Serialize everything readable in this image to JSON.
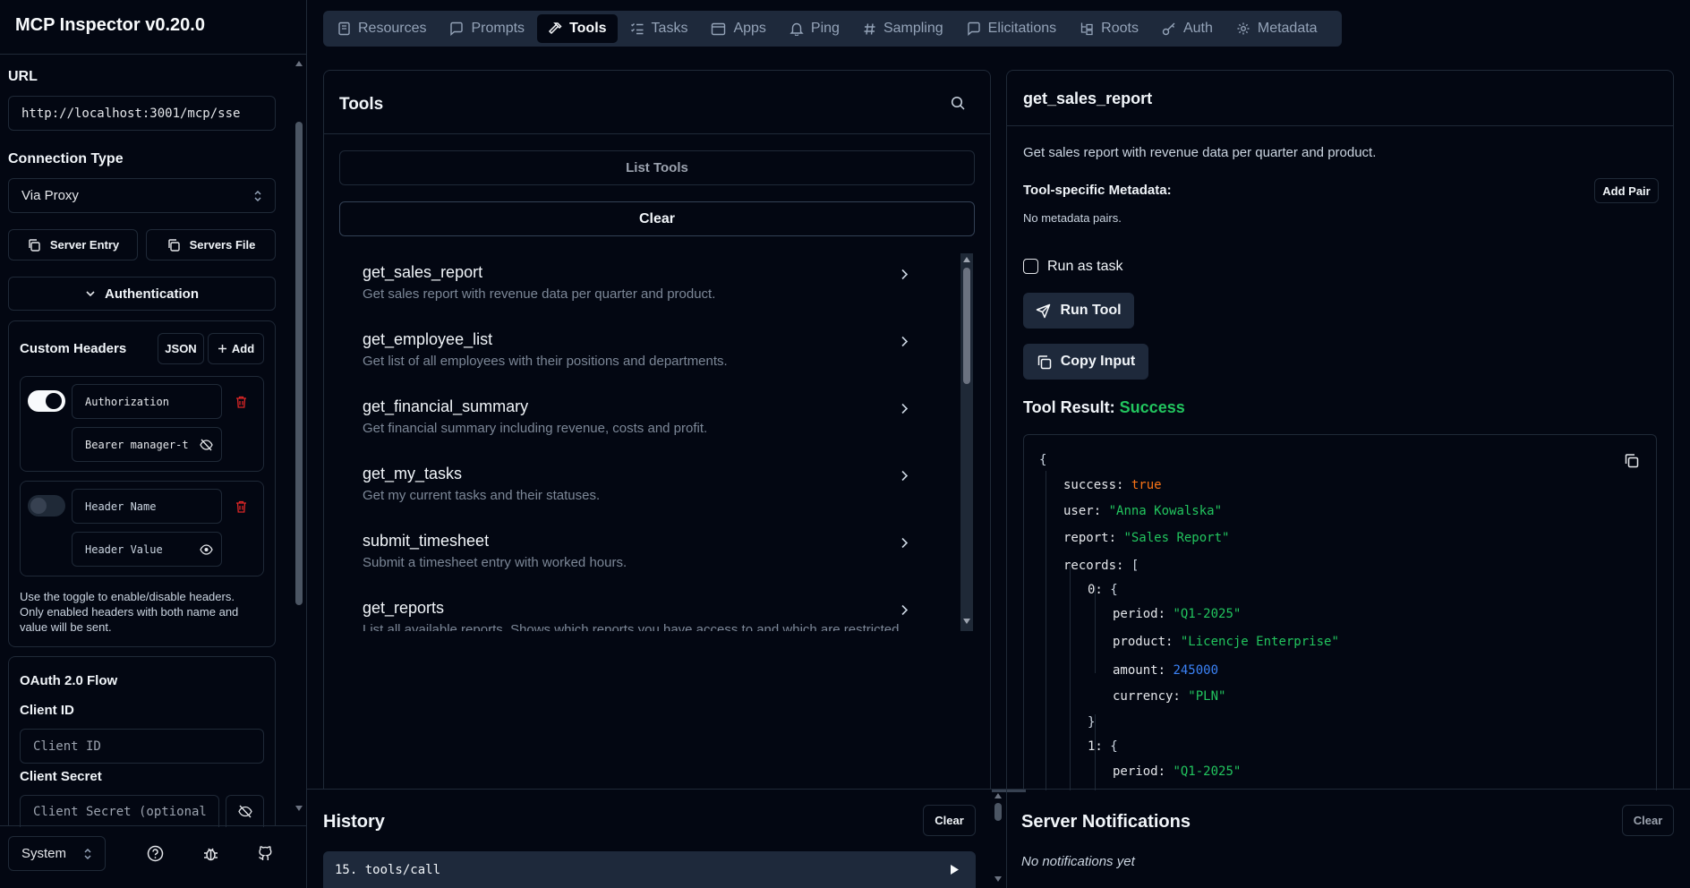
{
  "sidebar": {
    "app_title": "MCP Inspector v0.20.0",
    "url_label": "URL",
    "url_value": "http://localhost:3001/mcp/sse",
    "connection_type_label": "Connection Type",
    "connection_type_value": "Via Proxy",
    "server_entry_label": "Server Entry",
    "servers_file_label": "Servers File",
    "authentication_label": "Authentication",
    "custom_headers_label": "Custom Headers",
    "json_button": "JSON",
    "add_button": "Add",
    "header1_name": "Authorization",
    "header1_value": "Bearer manager-t⁠",
    "header2_name_placeholder": "Header Name",
    "header2_value_placeholder": "Header Value",
    "headers_hint": "Use the toggle to enable/disable headers. Only enabled headers with both name and value will be sent.",
    "oauth_title": "OAuth 2.0 Flow",
    "client_id_label": "Client ID",
    "client_id_placeholder": "Client ID",
    "client_secret_label": "Client Secret",
    "client_secret_placeholder": "Client Secret (optional",
    "theme_value": "System"
  },
  "tabs": [
    {
      "label": "Resources"
    },
    {
      "label": "Prompts"
    },
    {
      "label": "Tools"
    },
    {
      "label": "Tasks"
    },
    {
      "label": "Apps"
    },
    {
      "label": "Ping"
    },
    {
      "label": "Sampling"
    },
    {
      "label": "Elicitations"
    },
    {
      "label": "Roots"
    },
    {
      "label": "Auth"
    },
    {
      "label": "Metadata"
    }
  ],
  "tools_panel": {
    "title": "Tools",
    "list_tools_label": "List Tools",
    "clear_label": "Clear",
    "items": [
      {
        "name": "get_sales_report",
        "desc": "Get sales report with revenue data per quarter and product."
      },
      {
        "name": "get_employee_list",
        "desc": "Get list of all employees with their positions and departments."
      },
      {
        "name": "get_financial_summary",
        "desc": "Get financial summary including revenue, costs and profit."
      },
      {
        "name": "get_my_tasks",
        "desc": "Get my current tasks and their statuses."
      },
      {
        "name": "submit_timesheet",
        "desc": "Submit a timesheet entry with worked hours."
      },
      {
        "name": "get_reports",
        "desc": "List all available reports. Shows which reports you have access to and which are restricted."
      }
    ]
  },
  "detail": {
    "title": "get_sales_report",
    "description": "Get sales report with revenue data per quarter and product.",
    "metadata_label": "Tool-specific Metadata:",
    "add_pair_label": "Add Pair",
    "no_metadata": "No metadata pairs.",
    "run_as_task_label": "Run as task",
    "run_tool_label": "Run Tool",
    "copy_input_label": "Copy Input",
    "result_label": "Tool Result:",
    "result_status": "Success"
  },
  "json_result": {
    "open_brace": "{",
    "success_key": "success:",
    "success_val": "true",
    "user_key": "user:",
    "user_val": "\"Anna Kowalska\"",
    "report_key": "report:",
    "report_val": "\"Sales Report\"",
    "records_key": "records:",
    "records_open": "[",
    "idx0": "0:",
    "idx_open": "{",
    "period_key": "period:",
    "period_val": "\"Q1-2025\"",
    "product_key": "product:",
    "product_val": "\"Licencje Enterprise\"",
    "amount_key": "amount:",
    "amount_val": "245000",
    "currency_key": "currency:",
    "currency_val": "\"PLN\"",
    "close_brace": "}",
    "idx1": "1:",
    "period2_val": "\"Q1-2025\""
  },
  "history": {
    "title": "History",
    "clear_label": "Clear",
    "entry": "15. tools/call"
  },
  "notifications": {
    "title": "Server Notifications",
    "clear_label": "Clear",
    "empty": "No notifications yet"
  },
  "colors": {
    "background": "#030712",
    "border": "#1f2937",
    "success": "#22c55e",
    "delete": "#dc2626"
  }
}
